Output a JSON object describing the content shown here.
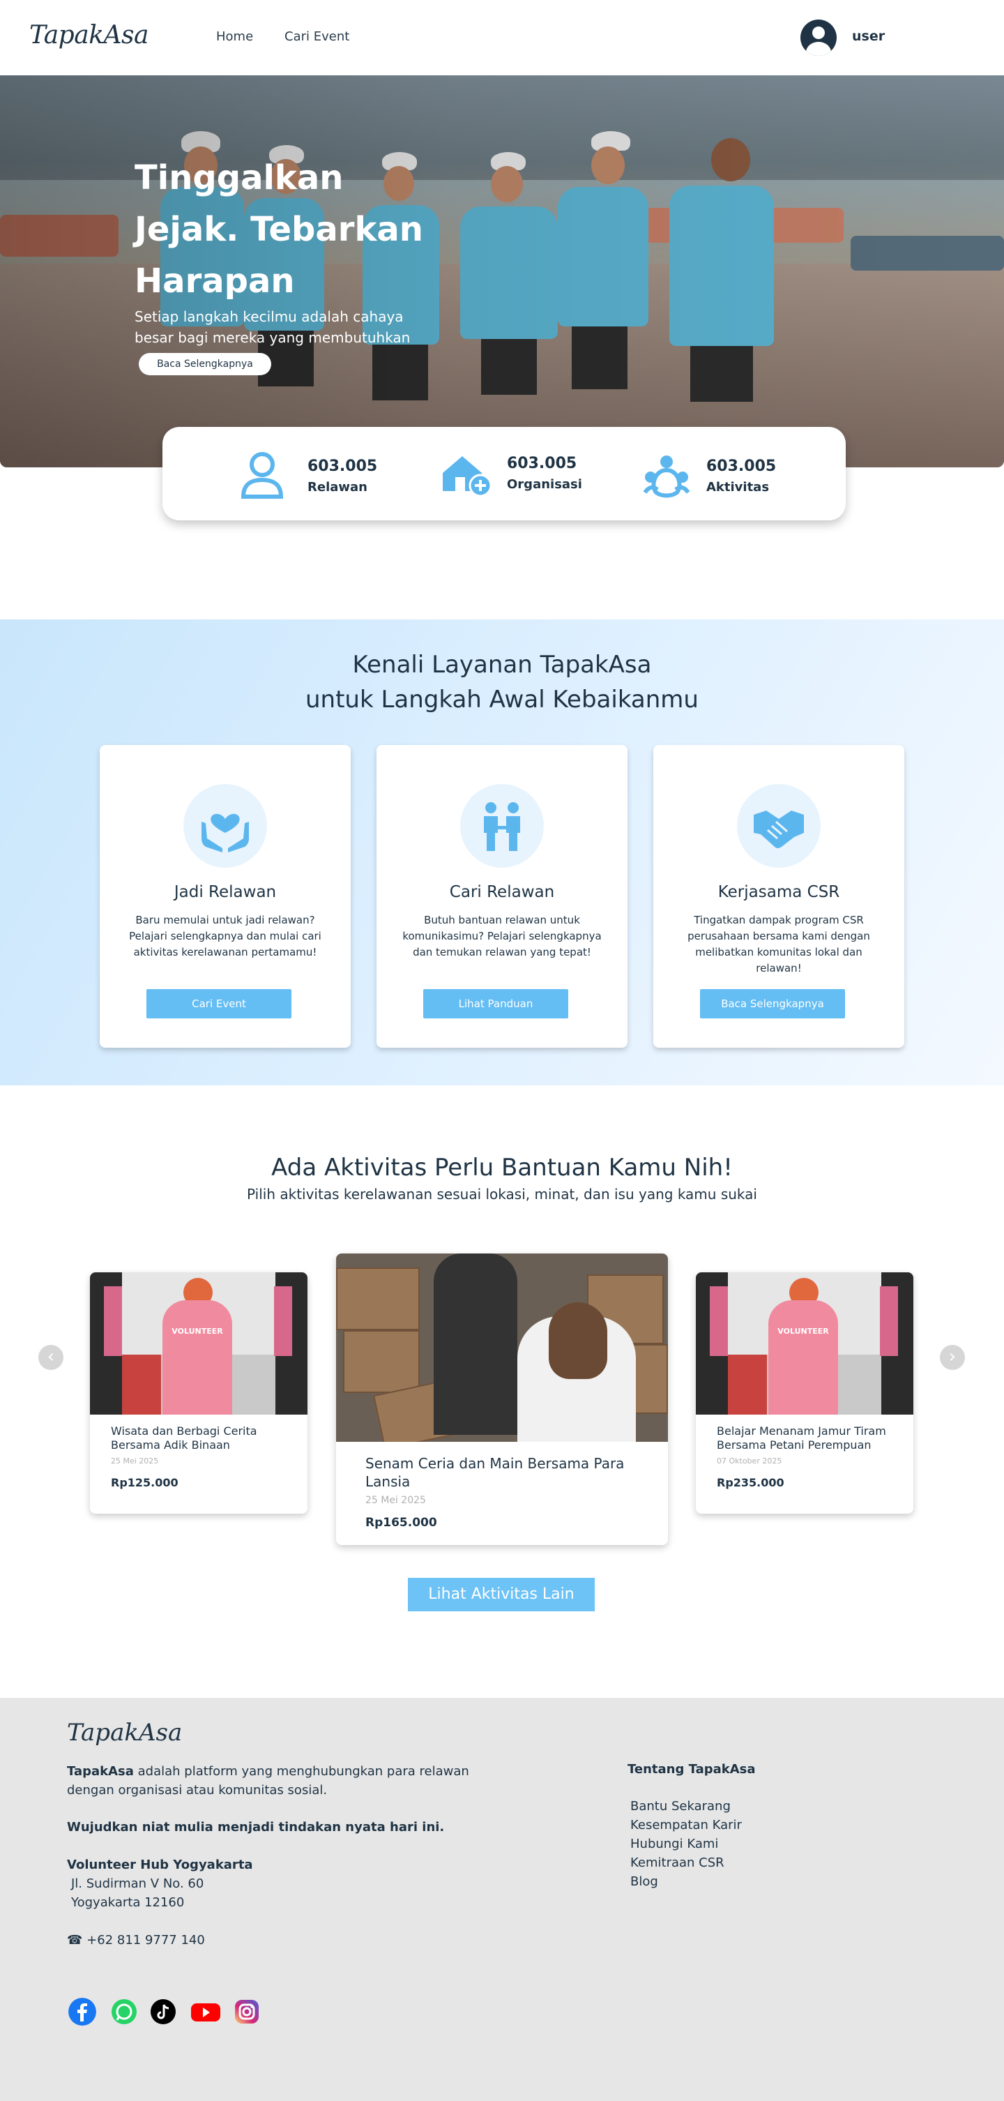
{
  "header": {
    "logo": "TapakAsa",
    "nav": [
      "Home",
      "Cari Event"
    ],
    "user": "user"
  },
  "hero": {
    "title": "Tinggalkan Jejak. Tebarkan Harapan",
    "subtitle": "Setiap langkah kecilmu adalah cahaya besar bagi mereka yang membutuhkan",
    "button": "Baca Selengkapnya"
  },
  "stats": [
    {
      "value": "603.005",
      "label": "Relawan",
      "icon": "person-icon"
    },
    {
      "value": "603.005",
      "label": "Organisasi",
      "icon": "house-add-icon"
    },
    {
      "value": "603.005",
      "label": "Aktivitas",
      "icon": "people-activity-icon"
    }
  ],
  "services": {
    "title_line1": "Kenali Layanan TapakAsa",
    "title_line2": "untuk Langkah Awal Kebaikanmu",
    "cards": [
      {
        "title": "Jadi Relawan",
        "desc": "Baru memulai untuk jadi relawan? Pelajari selengkapnya dan mulai cari aktivitas kerelawanan pertamamu!",
        "button": "Cari Event",
        "icon": "heart-hands-icon"
      },
      {
        "title": "Cari Relawan",
        "desc": "Butuh bantuan relawan untuk komunikasimu? Pelajari selengkapnya dan temukan relawan yang tepat!",
        "button": "Lihat Panduan",
        "icon": "two-people-icon"
      },
      {
        "title": "Kerjasama CSR",
        "desc": "Tingatkan dampak program CSR perusahaan bersama kami dengan melibatkan komunitas lokal dan relawan!",
        "button": "Baca Selengkapnya",
        "icon": "handshake-icon"
      }
    ]
  },
  "activities": {
    "title": "Ada Aktivitas Perlu Bantuan Kamu Nih!",
    "subtitle": "Pilih aktivitas kerelawanan sesuai lokasi, minat, dan isu yang kamu sukai",
    "items": [
      {
        "name": "Wisata dan Berbagi Cerita Bersama Adik Binaan",
        "date": "25 Mei 2025",
        "price": "Rp125.000"
      },
      {
        "name": "Senam Ceria dan Main Bersama Para Lansia",
        "date": "25 Mei 2025",
        "price": "Rp165.000"
      },
      {
        "name": "Belajar Menanam Jamur Tiram Bersama Petani Perempuan",
        "date": "07 Oktober 2025",
        "price": "Rp235.000"
      }
    ],
    "photo_label": "VOLUNTEER",
    "more_button": "Lihat Aktivitas Lain",
    "prev_arrow": "‹",
    "next_arrow": "›"
  },
  "footer": {
    "logo": "TapakAsa",
    "brand": "TapakAsa",
    "about": "adalah platform yang menghubungkan para relawan dengan organisasi atau komunitas sosial.",
    "tagline": "Wujudkan niat mulia menjadi tindakan nyata hari ini.",
    "org": "Volunteer Hub Yogyakarta",
    "address1": "Jl. Sudirman V No. 60",
    "address2": "Yogyakarta 12160",
    "phone": "+62 811 9777 140",
    "col_title": "Tentang TapakAsa",
    "links": [
      "Bantu Sekarang",
      "Kesempatan Karir",
      "Hubungi Kami",
      "Kemitraan CSR",
      "Blog"
    ],
    "social": [
      "facebook-icon",
      "whatsapp-icon",
      "tiktok-icon",
      "youtube-icon",
      "instagram-icon"
    ]
  },
  "colors": {
    "primary": "#1f3344",
    "accent": "#64bdf3",
    "icon_blue": "#5cb6ee",
    "footer_bg": "#e6e6e6"
  }
}
